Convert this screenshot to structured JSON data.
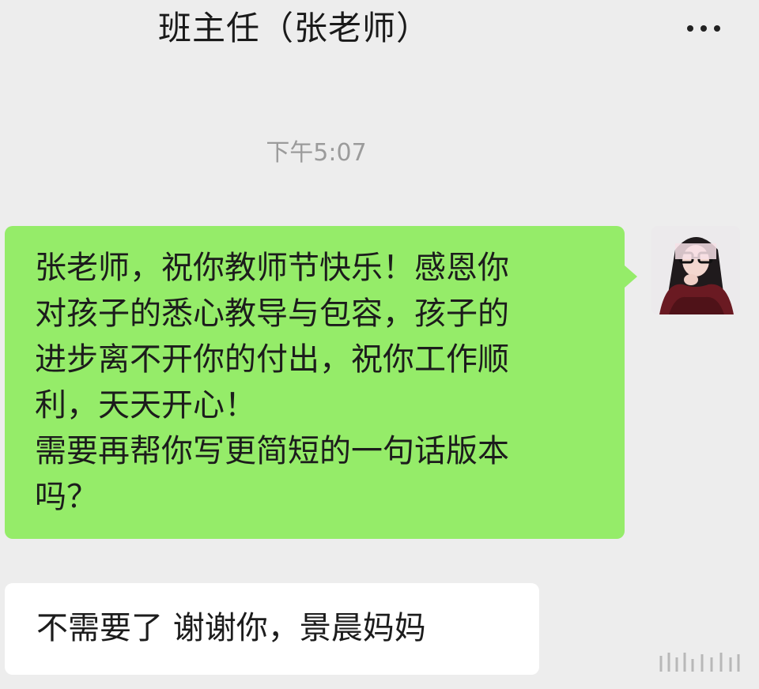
{
  "header": {
    "title": "班主任（张老师）",
    "more_icon": "more-horizontal-icon"
  },
  "chat": {
    "timestamp": "下午5:07",
    "messages": [
      {
        "direction": "sent",
        "text": "张老师，祝你教师节快乐！感恩你\n对孩子的悉心教导与包容，孩子的\n进步离不开你的付出，祝你工作顺\n利，天天开心！\n需要再帮你写更简短的一句话版本\n吗？"
      },
      {
        "direction": "received",
        "text": "不需要了  谢谢你，景晨妈妈"
      }
    ]
  },
  "colors": {
    "background": "#ededed",
    "sent_bubble": "#95ec69",
    "received_bubble": "#ffffff",
    "timestamp": "#9b9b9b"
  }
}
